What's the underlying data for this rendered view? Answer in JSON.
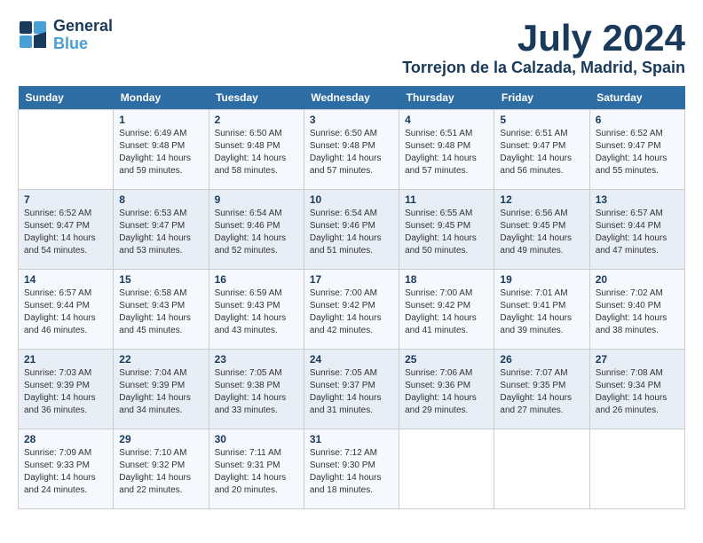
{
  "header": {
    "logo_line1": "General",
    "logo_line2": "Blue",
    "month": "July 2024",
    "location": "Torrejon de la Calzada, Madrid, Spain"
  },
  "weekdays": [
    "Sunday",
    "Monday",
    "Tuesday",
    "Wednesday",
    "Thursday",
    "Friday",
    "Saturday"
  ],
  "weeks": [
    [
      {
        "day": "",
        "info": ""
      },
      {
        "day": "1",
        "info": "Sunrise: 6:49 AM\nSunset: 9:48 PM\nDaylight: 14 hours\nand 59 minutes."
      },
      {
        "day": "2",
        "info": "Sunrise: 6:50 AM\nSunset: 9:48 PM\nDaylight: 14 hours\nand 58 minutes."
      },
      {
        "day": "3",
        "info": "Sunrise: 6:50 AM\nSunset: 9:48 PM\nDaylight: 14 hours\nand 57 minutes."
      },
      {
        "day": "4",
        "info": "Sunrise: 6:51 AM\nSunset: 9:48 PM\nDaylight: 14 hours\nand 57 minutes."
      },
      {
        "day": "5",
        "info": "Sunrise: 6:51 AM\nSunset: 9:47 PM\nDaylight: 14 hours\nand 56 minutes."
      },
      {
        "day": "6",
        "info": "Sunrise: 6:52 AM\nSunset: 9:47 PM\nDaylight: 14 hours\nand 55 minutes."
      }
    ],
    [
      {
        "day": "7",
        "info": "Sunrise: 6:52 AM\nSunset: 9:47 PM\nDaylight: 14 hours\nand 54 minutes."
      },
      {
        "day": "8",
        "info": "Sunrise: 6:53 AM\nSunset: 9:47 PM\nDaylight: 14 hours\nand 53 minutes."
      },
      {
        "day": "9",
        "info": "Sunrise: 6:54 AM\nSunset: 9:46 PM\nDaylight: 14 hours\nand 52 minutes."
      },
      {
        "day": "10",
        "info": "Sunrise: 6:54 AM\nSunset: 9:46 PM\nDaylight: 14 hours\nand 51 minutes."
      },
      {
        "day": "11",
        "info": "Sunrise: 6:55 AM\nSunset: 9:45 PM\nDaylight: 14 hours\nand 50 minutes."
      },
      {
        "day": "12",
        "info": "Sunrise: 6:56 AM\nSunset: 9:45 PM\nDaylight: 14 hours\nand 49 minutes."
      },
      {
        "day": "13",
        "info": "Sunrise: 6:57 AM\nSunset: 9:44 PM\nDaylight: 14 hours\nand 47 minutes."
      }
    ],
    [
      {
        "day": "14",
        "info": "Sunrise: 6:57 AM\nSunset: 9:44 PM\nDaylight: 14 hours\nand 46 minutes."
      },
      {
        "day": "15",
        "info": "Sunrise: 6:58 AM\nSunset: 9:43 PM\nDaylight: 14 hours\nand 45 minutes."
      },
      {
        "day": "16",
        "info": "Sunrise: 6:59 AM\nSunset: 9:43 PM\nDaylight: 14 hours\nand 43 minutes."
      },
      {
        "day": "17",
        "info": "Sunrise: 7:00 AM\nSunset: 9:42 PM\nDaylight: 14 hours\nand 42 minutes."
      },
      {
        "day": "18",
        "info": "Sunrise: 7:00 AM\nSunset: 9:42 PM\nDaylight: 14 hours\nand 41 minutes."
      },
      {
        "day": "19",
        "info": "Sunrise: 7:01 AM\nSunset: 9:41 PM\nDaylight: 14 hours\nand 39 minutes."
      },
      {
        "day": "20",
        "info": "Sunrise: 7:02 AM\nSunset: 9:40 PM\nDaylight: 14 hours\nand 38 minutes."
      }
    ],
    [
      {
        "day": "21",
        "info": "Sunrise: 7:03 AM\nSunset: 9:39 PM\nDaylight: 14 hours\nand 36 minutes."
      },
      {
        "day": "22",
        "info": "Sunrise: 7:04 AM\nSunset: 9:39 PM\nDaylight: 14 hours\nand 34 minutes."
      },
      {
        "day": "23",
        "info": "Sunrise: 7:05 AM\nSunset: 9:38 PM\nDaylight: 14 hours\nand 33 minutes."
      },
      {
        "day": "24",
        "info": "Sunrise: 7:05 AM\nSunset: 9:37 PM\nDaylight: 14 hours\nand 31 minutes."
      },
      {
        "day": "25",
        "info": "Sunrise: 7:06 AM\nSunset: 9:36 PM\nDaylight: 14 hours\nand 29 minutes."
      },
      {
        "day": "26",
        "info": "Sunrise: 7:07 AM\nSunset: 9:35 PM\nDaylight: 14 hours\nand 27 minutes."
      },
      {
        "day": "27",
        "info": "Sunrise: 7:08 AM\nSunset: 9:34 PM\nDaylight: 14 hours\nand 26 minutes."
      }
    ],
    [
      {
        "day": "28",
        "info": "Sunrise: 7:09 AM\nSunset: 9:33 PM\nDaylight: 14 hours\nand 24 minutes."
      },
      {
        "day": "29",
        "info": "Sunrise: 7:10 AM\nSunset: 9:32 PM\nDaylight: 14 hours\nand 22 minutes."
      },
      {
        "day": "30",
        "info": "Sunrise: 7:11 AM\nSunset: 9:31 PM\nDaylight: 14 hours\nand 20 minutes."
      },
      {
        "day": "31",
        "info": "Sunrise: 7:12 AM\nSunset: 9:30 PM\nDaylight: 14 hours\nand 18 minutes."
      },
      {
        "day": "",
        "info": ""
      },
      {
        "day": "",
        "info": ""
      },
      {
        "day": "",
        "info": ""
      }
    ]
  ]
}
